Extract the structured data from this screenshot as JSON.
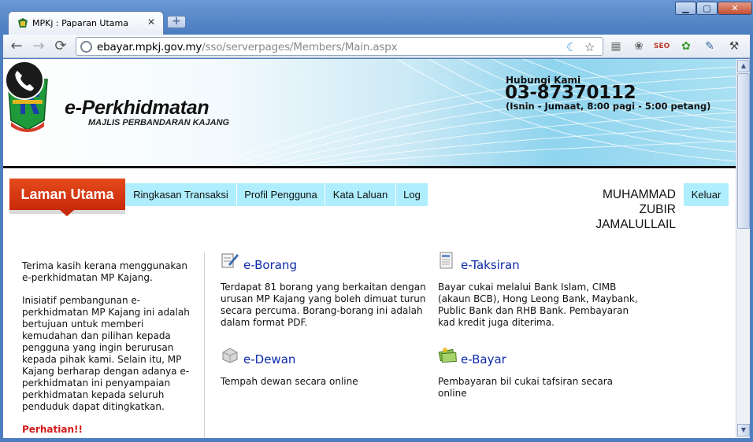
{
  "browser": {
    "tab_title": "MPKj : Paparan Utama",
    "tab_close": "✕",
    "new_tab": "+",
    "url_host": "ebayar.mpkj.gov.my",
    "url_path": "/sso/serverpages/Members/Main.aspx",
    "window_controls": {
      "minimize": "▁",
      "maximize": "▢",
      "close": "✕"
    },
    "nav": {
      "back": "←",
      "forward": "→",
      "reload": "⟳"
    },
    "extensions": [
      "apps-icon",
      "puzzle-icon",
      "seo-icon",
      "green-icon",
      "eyedropper-icon",
      "wrench-icon"
    ],
    "ext_seo_label": "SEO"
  },
  "header": {
    "brand_title": "e-Perkhidmatan",
    "brand_subtitle": "MAJLIS PERBANDARAN KAJANG",
    "contact_label": "Hubungi Kami",
    "contact_phone": "03-87370112",
    "contact_hours": "(Isnin - Jumaat, 8:00 pagi - 5:00 petang)"
  },
  "nav": {
    "home": "Laman Utama",
    "items": [
      "Ringkasan Transaksi",
      "Profil Pengguna",
      "Kata Laluan",
      "Log"
    ],
    "user_name": "MUHAMMAD ZUBIR JAMALULLAIL",
    "logout": "Keluar"
  },
  "intro": {
    "p1": "Terima kasih kerana menggunakan e-perkhidmatan MP Kajang.",
    "p2": "Inisiatif pembangunan e-perkhidmatan MP Kajang ini adalah bertujuan untuk memberi kemudahan dan pilihan kepada pengguna yang ingin berurusan kepada pihak kami. Selain itu, MP Kajang berharap dengan adanya e-perkhidmatan ini penyampaian perkhidmatan kepada seluruh penduduk dapat ditingkatkan.",
    "warning": "Perhatian!!"
  },
  "services": [
    {
      "title": "e-Borang",
      "icon": "form-pen-icon",
      "desc": "Terdapat 81 borang yang berkaitan dengan urusan MP Kajang yang boleh dimuat turun secara percuma. Borang-borang ini adalah dalam format PDF."
    },
    {
      "title": "e-Taksiran",
      "icon": "document-icon",
      "desc": "Bayar cukai melalui Bank Islam, CIMB (akaun BCB), Hong Leong Bank, Maybank, Public Bank dan RHB Bank. Pembayaran kad kredit juga diterima."
    },
    {
      "title": "e-Dewan",
      "icon": "building-icon",
      "desc": "Tempah dewan secara online"
    },
    {
      "title": "e-Bayar",
      "icon": "money-icon",
      "desc": "Pembayaran bil cukai tafsiran secara online"
    }
  ],
  "colors": {
    "accent_red": "#c8290a",
    "nav_bg": "#aeeefe",
    "link_blue": "#0d2aa8",
    "warning_red": "#d21a1a"
  }
}
